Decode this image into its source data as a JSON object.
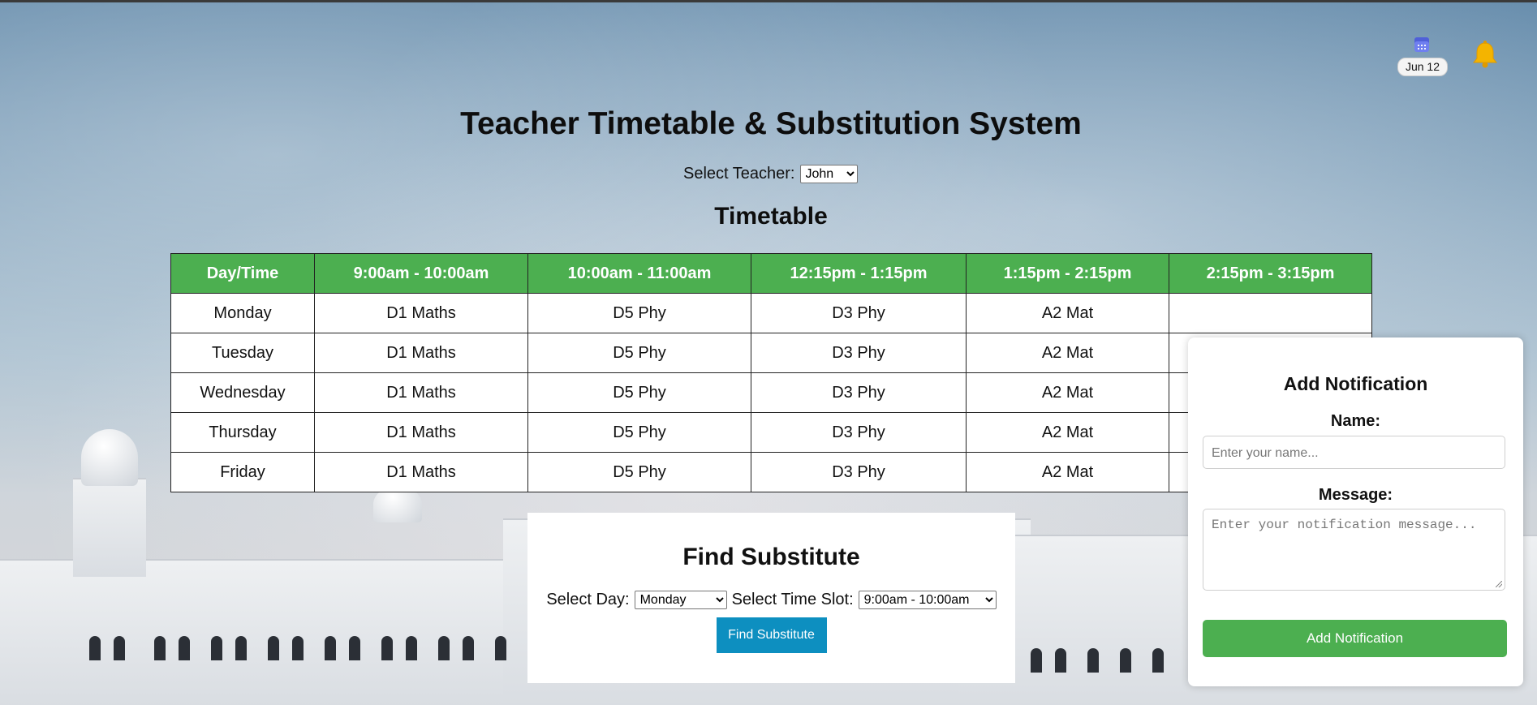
{
  "header": {
    "date_label": "Jun 12",
    "calendar_icon": "calendar-icon",
    "bell_icon": "bell-icon"
  },
  "title": "Teacher Timetable & Substitution System",
  "teacher_select": {
    "label": "Select Teacher:",
    "value": "John"
  },
  "timetable": {
    "title": "Timetable",
    "columns": [
      "Day/Time",
      "9:00am - 10:00am",
      "10:00am - 11:00am",
      "12:15pm - 1:15pm",
      "1:15pm - 2:15pm",
      "2:15pm - 3:15pm"
    ],
    "rows": [
      [
        "Monday",
        "D1 Maths",
        "D5 Phy",
        "D3 Phy",
        "A2 Mat",
        ""
      ],
      [
        "Tuesday",
        "D1 Maths",
        "D5 Phy",
        "D3 Phy",
        "A2 Mat",
        ""
      ],
      [
        "Wednesday",
        "D1 Maths",
        "D5 Phy",
        "D3 Phy",
        "A2 Mat",
        ""
      ],
      [
        "Thursday",
        "D1 Maths",
        "D5 Phy",
        "D3 Phy",
        "A2 Mat",
        ""
      ],
      [
        "Friday",
        "D1 Maths",
        "D5 Phy",
        "D3 Phy",
        "A2 Mat",
        ""
      ]
    ],
    "header_color": "#4caf50"
  },
  "substitute": {
    "title": "Find Substitute",
    "day_label": "Select Day:",
    "day_value": "Monday",
    "slot_label": "Select Time Slot:",
    "slot_value": "9:00am - 10:00am",
    "button_label": "Find Substitute",
    "button_color": "#0d8fc0"
  },
  "notification": {
    "title": "Add Notification",
    "name_label": "Name:",
    "name_placeholder": "Enter your name...",
    "message_label": "Message:",
    "message_placeholder": "Enter your notification message...",
    "button_label": "Add Notification",
    "button_color": "#4caf50"
  }
}
